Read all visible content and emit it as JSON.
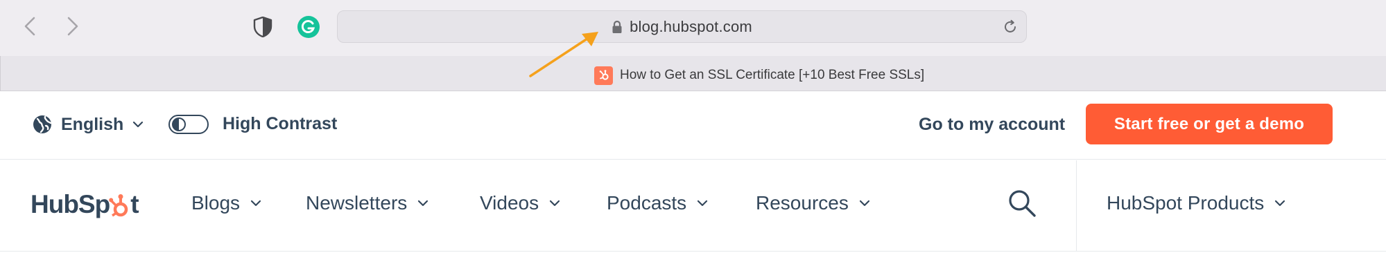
{
  "browser": {
    "url": "blog.hubspot.com",
    "tab_title": "How to Get an SSL Certificate [+10 Best Free SSLs]",
    "icons": [
      "back-icon",
      "forward-icon",
      "shield-icon",
      "grammarly-icon",
      "lock-icon",
      "reload-icon",
      "hubspot-favicon-icon"
    ],
    "annotation_arrow_color": "#f5a11c"
  },
  "utility": {
    "language_label": "English",
    "contrast_label": "High Contrast",
    "account_link": "Go to my account",
    "cta_label": "Start free or get a demo",
    "cta_color": "#ff5c35"
  },
  "nav": {
    "logo_text_left": "HubSp",
    "logo_text_right": "t",
    "items": [
      {
        "label": "Blogs"
      },
      {
        "label": "Newsletters"
      },
      {
        "label": "Videos"
      },
      {
        "label": "Podcasts"
      },
      {
        "label": "Resources"
      }
    ],
    "products_label": "HubSpot Products",
    "text_color": "#33475b",
    "brand_orange": "#ff7a59"
  }
}
